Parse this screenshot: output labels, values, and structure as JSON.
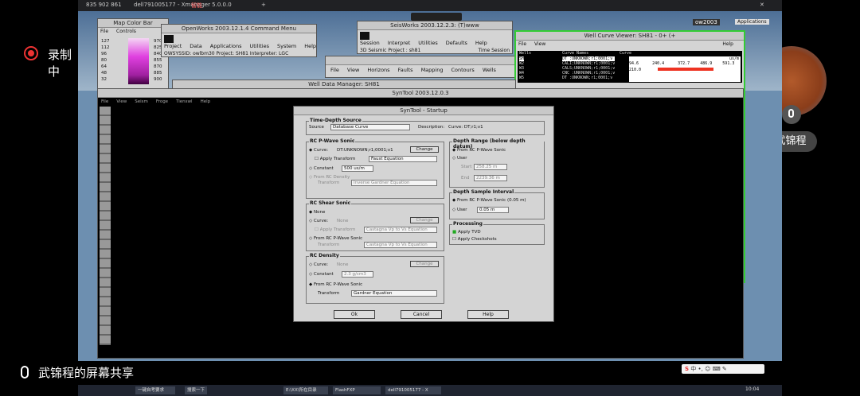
{
  "overlay": {
    "recording_label": "录制中",
    "presenter_name": "武锦程",
    "share_label": "武锦程的屏幕共享"
  },
  "phone": {
    "meeting_id": "835 902 861",
    "tab_title": "智能",
    "plus": "+"
  },
  "xmanager": {
    "title": "dell791005177 - Xmanager 5.0.0.0"
  },
  "map_color_bar": {
    "title": "Map Color Bar",
    "menu": [
      "File",
      "Controls"
    ],
    "scale": [
      "127",
      "112",
      "96",
      "80",
      "64",
      "48",
      "32"
    ],
    "scale_right": [
      "970",
      "825",
      "840",
      "855",
      "870",
      "885",
      "900"
    ]
  },
  "openworks": {
    "title": "OpenWorks 2003.12.1.4 Command Menu",
    "menu": [
      "Project",
      "Data",
      "Applications",
      "Utilities",
      "System",
      "Help"
    ],
    "status": "OWSYSSID: owlbm30   Project: SH81   Interpreter: LGC"
  },
  "seisworks": {
    "title": "SeisWorks 2003.12.2.3: (T)www",
    "menu": [
      "Session",
      "Interpret",
      "Utilities",
      "Defaults",
      "Help"
    ],
    "project": "3D Seismic Project :  sh81",
    "time_session": "Time Session"
  },
  "seis_sub": {
    "menu": [
      "File",
      "View",
      "Horizons",
      "Faults",
      "Mapping",
      "Contours",
      "Wells"
    ]
  },
  "well_viewer": {
    "title": "Well Curve Viewer: SH81 - 0+ (+",
    "menu": [
      "File",
      "View"
    ],
    "help": "Help",
    "headers": [
      "Wells",
      "Curve Names",
      "Curve"
    ],
    "wells": [
      "SH",
      "W2",
      "W3",
      "W4",
      "W5"
    ],
    "curves": [
      "DT :UNKNOWN;r1;0001;v",
      "CALI;UNKNOWN;r1;0001;v",
      "CALS;UNKNOWN;r1;0001;v",
      "CNC :UNKNOWN;r1;0001;v",
      "DT :UNKNOWN;r1;0001;v"
    ],
    "scale": [
      "94.6",
      "240.4",
      "372.7",
      "486.9",
      "591.3"
    ],
    "depth": "210.0",
    "unit": "us/m"
  },
  "well_data_manager": {
    "title": "Well Data Manager: SH81"
  },
  "syntool": {
    "title": "SynTool 2003.12.0.3",
    "menu": [
      "File",
      "View",
      "Seism",
      "Froge",
      "Tienswl",
      "Help"
    ]
  },
  "startup": {
    "title": "SynTool - Startup",
    "tds": {
      "title": "Time-Depth Source",
      "source_label": "Source",
      "source_value": "Database Curve",
      "desc_label": "Description:",
      "desc_value": "Curve: DT;r1;v1"
    },
    "pwave": {
      "title": "RC P-Wave Sonic",
      "curve_label": "Curve:",
      "curve_value": "DT:UNKNOWN;r1;0001;v1",
      "change": "Change",
      "apply": "Apply Transform",
      "apply_value": "Faust Equation",
      "constant": "Constant",
      "constant_value": "500 us/m",
      "from_rc": "From RC Density",
      "transform": "Transform",
      "transform_value": "Inverse Gardner Equation"
    },
    "shear": {
      "title": "RC Shear Sonic",
      "none": "None",
      "curve_label": "Curve:",
      "curve_value": "None",
      "change": "Change",
      "apply": "Apply Transform",
      "apply_value": "Castagna Vp to Vs Equation",
      "from": "From RC P-Wave Sonic",
      "transform": "Transform",
      "transform_value": "Castagna Vp to Vs Equation"
    },
    "density": {
      "title": "RC Density",
      "curve_label": "Curve:",
      "curve_value": "None",
      "change": "Change",
      "constant": "Constant",
      "constant_value": "2.3 g/cm3",
      "from": "From RC P-Wave Sonic",
      "transform": "Transform",
      "transform_value": "Gardner Equation"
    },
    "depth_range": {
      "title": "Depth Range (below depth datum)",
      "from": "From RC P-Wave Sonic",
      "user": "User",
      "start_label": "Start",
      "start_value": "258.25 m",
      "end_label": "End",
      "end_value": "2239.36 m"
    },
    "interval": {
      "title": "Depth Sample Interval",
      "from": "From RC P-Wave Sonic (0.05 m)",
      "user": "User",
      "user_value": "0.05 m"
    },
    "processing": {
      "title": "Processing",
      "tvd": "Apply TVD",
      "checkshots": "Apply Checkshots"
    },
    "buttons": {
      "ok": "Ok",
      "cancel": "Cancel",
      "help": "Help"
    }
  },
  "top_right": {
    "user": "ow2003",
    "apps": "Applications"
  },
  "taskbar": {
    "items": [
      "一键自考要求",
      "搜索一下",
      "E:\\XX\\所在目录",
      "FlashFXP",
      "dell791005177 - X"
    ],
    "time": "10:04",
    "tray": "中"
  }
}
